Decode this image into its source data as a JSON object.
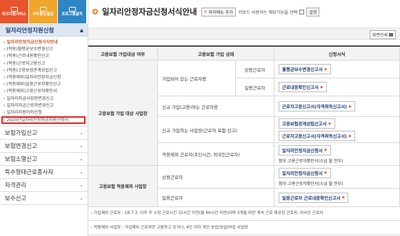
{
  "quick_links": [
    {
      "label": "워크지원서비스",
      "color": "#e8542c"
    },
    {
      "label": "자주묻는질문",
      "color": "#f0a52b"
    },
    {
      "label": "프로그램설치",
      "color": "#2f86c5"
    }
  ],
  "sidebar": {
    "section_title": "일자리안정지원신청",
    "sub_items": [
      "› 일자리안정자금신청서식안내",
      "› (적용)월평균보수변경신고",
      "› (적용)근로내용확인신고",
      "› (적용)근로자고용신고",
      "› (적용)고용보험관계성립신고",
      "› (적용제외)일자리안정자금신청",
      "› (적용제외)일용근로자확인신고",
      "› (적용제외)고용근로자확인서",
      "› 일자리자금사업장변경신고",
      "› 일자리자금근로자변경신고",
      "› 일자리지원이의신청",
      "› 2020년일자리안정자금지원신청서"
    ],
    "main_items": [
      "보험가입신고",
      "보험변경신고",
      "보험소멸신고",
      "특수형태근로종사자",
      "자격관리",
      "보수신고"
    ]
  },
  "header": {
    "title": "일자리안정자금신청서식안내",
    "mymenu_label": "마이메뉴 추가",
    "keyboard_text": "키보드 사용자는 해당기능을 선택",
    "desc_label": "설명",
    "print_label": "화면인쇄"
  },
  "table": {
    "headers": [
      "고용보험 가입대상 여부",
      "고용보험 가입 상태",
      "신청서식"
    ],
    "group1_label": "고용보험 가입 대상 사업장",
    "group2_label": "고용보험 적용제외 사업장",
    "rows": {
      "employed": "가입되어 있는 근로자용",
      "regular": "상용근로자",
      "daily": "일용근로자",
      "new_worker": "신규 가입(고용)하는 근로자용",
      "new_site": "신규 가입하는 사업장(근로자 포함 신고)",
      "excluded_worker": "적용제외 근로자(초단시간, 외국인근로자)",
      "g2_regular": "상용근로자",
      "g2_daily": "일용근로자"
    },
    "forms": {
      "wage_change": "월평균보수변경신고서",
      "work_confirm": "근로내용확인신고서",
      "hire_report": "근로자고용신고서(자격취득신고서)",
      "insurance_est": "고용보험관계성립신고서",
      "hire_report2": "근로자고용신고서(자격취득신고서)",
      "fund_app": "일자리안정자금신청서",
      "attach1": "첨부:고용근로자확인서(소급 월 전부)",
      "fund_app2": "일자리안정자금신청서",
      "attach2": "첨부:고용근로자확인서(소급 월 전부)",
      "g2_daily_form": "일용근로자 근로내용확인신고서"
    }
  },
  "notes": [
    "- 가입제외 근로자 : 18.7.3. 이후 주 소정 근로시간 15시간 미만(월 60시간 미만)이며 3개월 미만 계속 근로 제공한 근로자, 외국인 근로자",
    "- 적용제외 사업장 : 가입제외 근로자만 고용하고 있거나, 4인 이하 개인 농업/임업/어업 사업장"
  ]
}
